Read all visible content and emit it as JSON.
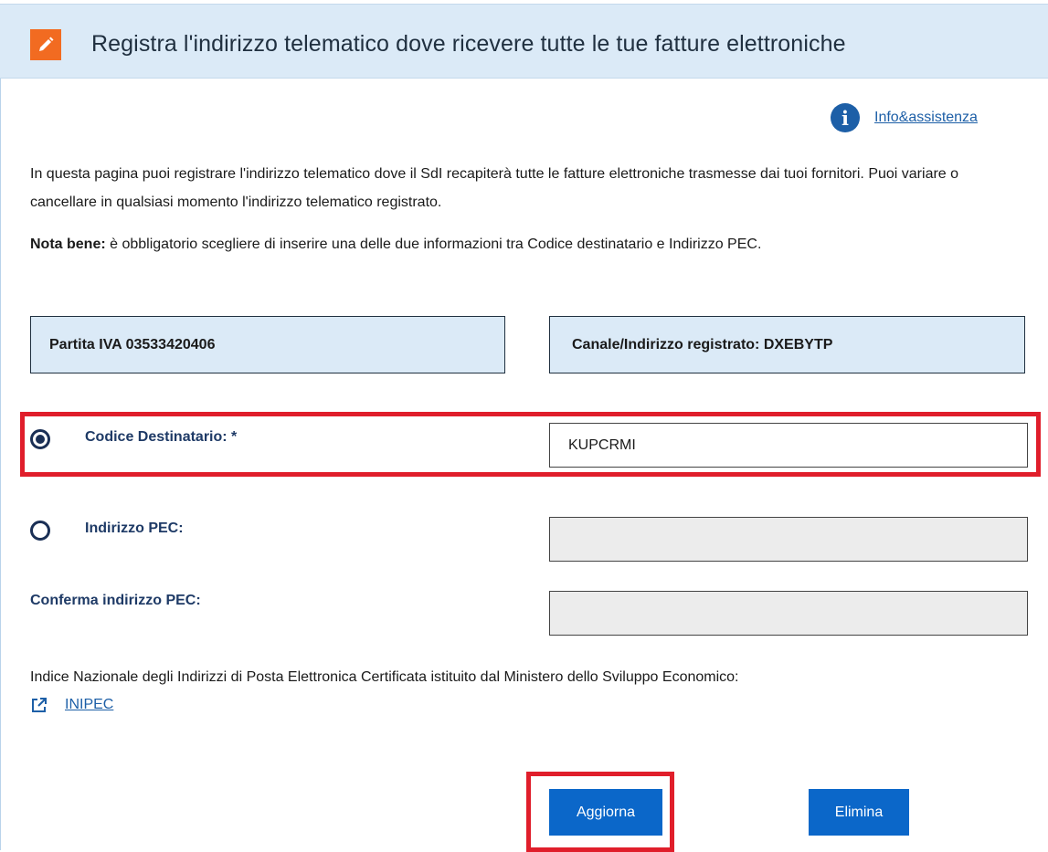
{
  "header": {
    "title": "Registra l'indirizzo telematico dove ricevere tutte le tue fatture elettroniche",
    "icon": "pencil-edit-icon",
    "accent_color": "#f26b21"
  },
  "help": {
    "link_label": "Info&assistenza",
    "icon": "info-icon"
  },
  "intro_text": "In questa pagina puoi registrare l'indirizzo telematico dove il SdI recapiterà tutte le fatture elettroniche trasmesse dai tuoi fornitori. Puoi variare o cancellare in qualsiasi momento l'indirizzo telematico registrato.",
  "note": {
    "label": "Nota bene:",
    "text": " è obbligatorio scegliere di inserire una delle due informazioni tra Codice destinatario e Indirizzo PEC."
  },
  "info_boxes": {
    "partita_iva": "Partita IVA 03533420406",
    "canale": "Canale/Indirizzo registrato: DXEBYTP"
  },
  "form": {
    "codice_destinatario": {
      "label": "Codice Destinatario: *",
      "value": "KUPCRMI",
      "selected": true
    },
    "indirizzo_pec": {
      "label": "Indirizzo PEC:",
      "value": "",
      "selected": false
    },
    "conferma_pec": {
      "label": "Conferma indirizzo PEC:",
      "value": ""
    }
  },
  "inipec": {
    "description": "Indice Nazionale degli Indirizzi di Posta Elettronica Certificata istituito dal Ministero dello Sviluppo Economico:",
    "link_label": "INIPEC",
    "icon": "external-link-icon"
  },
  "actions": {
    "update_label": "Aggiorna",
    "delete_label": "Elimina"
  },
  "colors": {
    "header_bg": "#dbeaf7",
    "primary_button": "#0b67c9",
    "highlight": "#e01e2b",
    "link": "#1d5fa7"
  }
}
